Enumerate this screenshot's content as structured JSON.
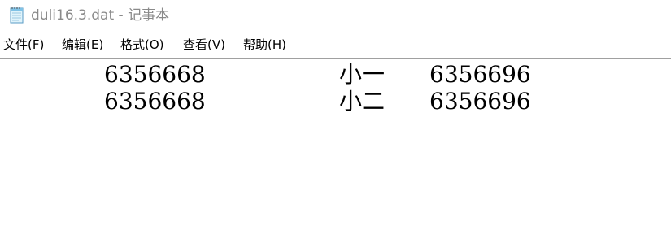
{
  "window": {
    "title": "duli16.3.dat - 记事本",
    "app_icon": "notepad-icon"
  },
  "menubar": {
    "items": [
      {
        "label": "文件(F)"
      },
      {
        "label": "编辑(E)"
      },
      {
        "label": "格式(O)"
      },
      {
        "label": "查看(V)"
      },
      {
        "label": "帮助(H)"
      }
    ]
  },
  "document": {
    "lines": [
      {
        "col1": "6356668",
        "col2": "小一",
        "col3": "6356696"
      },
      {
        "col1": "6356668",
        "col2": "小二",
        "col3": "6356696"
      }
    ]
  }
}
